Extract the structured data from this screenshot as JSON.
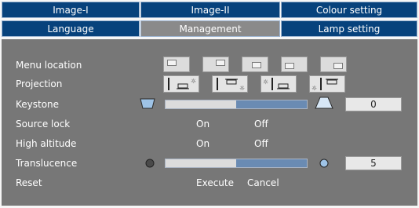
{
  "tabs": {
    "row1": [
      {
        "label": "Image-I",
        "active": false
      },
      {
        "label": "Image-II",
        "active": false
      },
      {
        "label": "Colour setting",
        "active": false
      }
    ],
    "row2": [
      {
        "label": "Language",
        "active": false
      },
      {
        "label": "Management",
        "active": true
      },
      {
        "label": "Lamp setting",
        "active": false
      }
    ]
  },
  "settings": {
    "menu_location": {
      "label": "Menu location",
      "selected_index": 0
    },
    "projection": {
      "label": "Projection",
      "selected_index": 0
    },
    "keystone": {
      "label": "Keystone",
      "value": "0",
      "level": 0.5
    },
    "source_lock": {
      "label": "Source lock",
      "on": "On",
      "off": "Off"
    },
    "high_altitude": {
      "label": "High altitude",
      "on": "On",
      "off": "Off"
    },
    "translucence": {
      "label": "Translucence",
      "value": "5",
      "level": 0.5
    },
    "reset": {
      "label": "Reset",
      "execute": "Execute",
      "cancel": "Cancel"
    }
  },
  "colors": {
    "tab_bg": "#07427c",
    "tab_active_bg": "#8a8a8a",
    "panel_bg": "#777777",
    "slider_fill": "#6a8bb3"
  }
}
